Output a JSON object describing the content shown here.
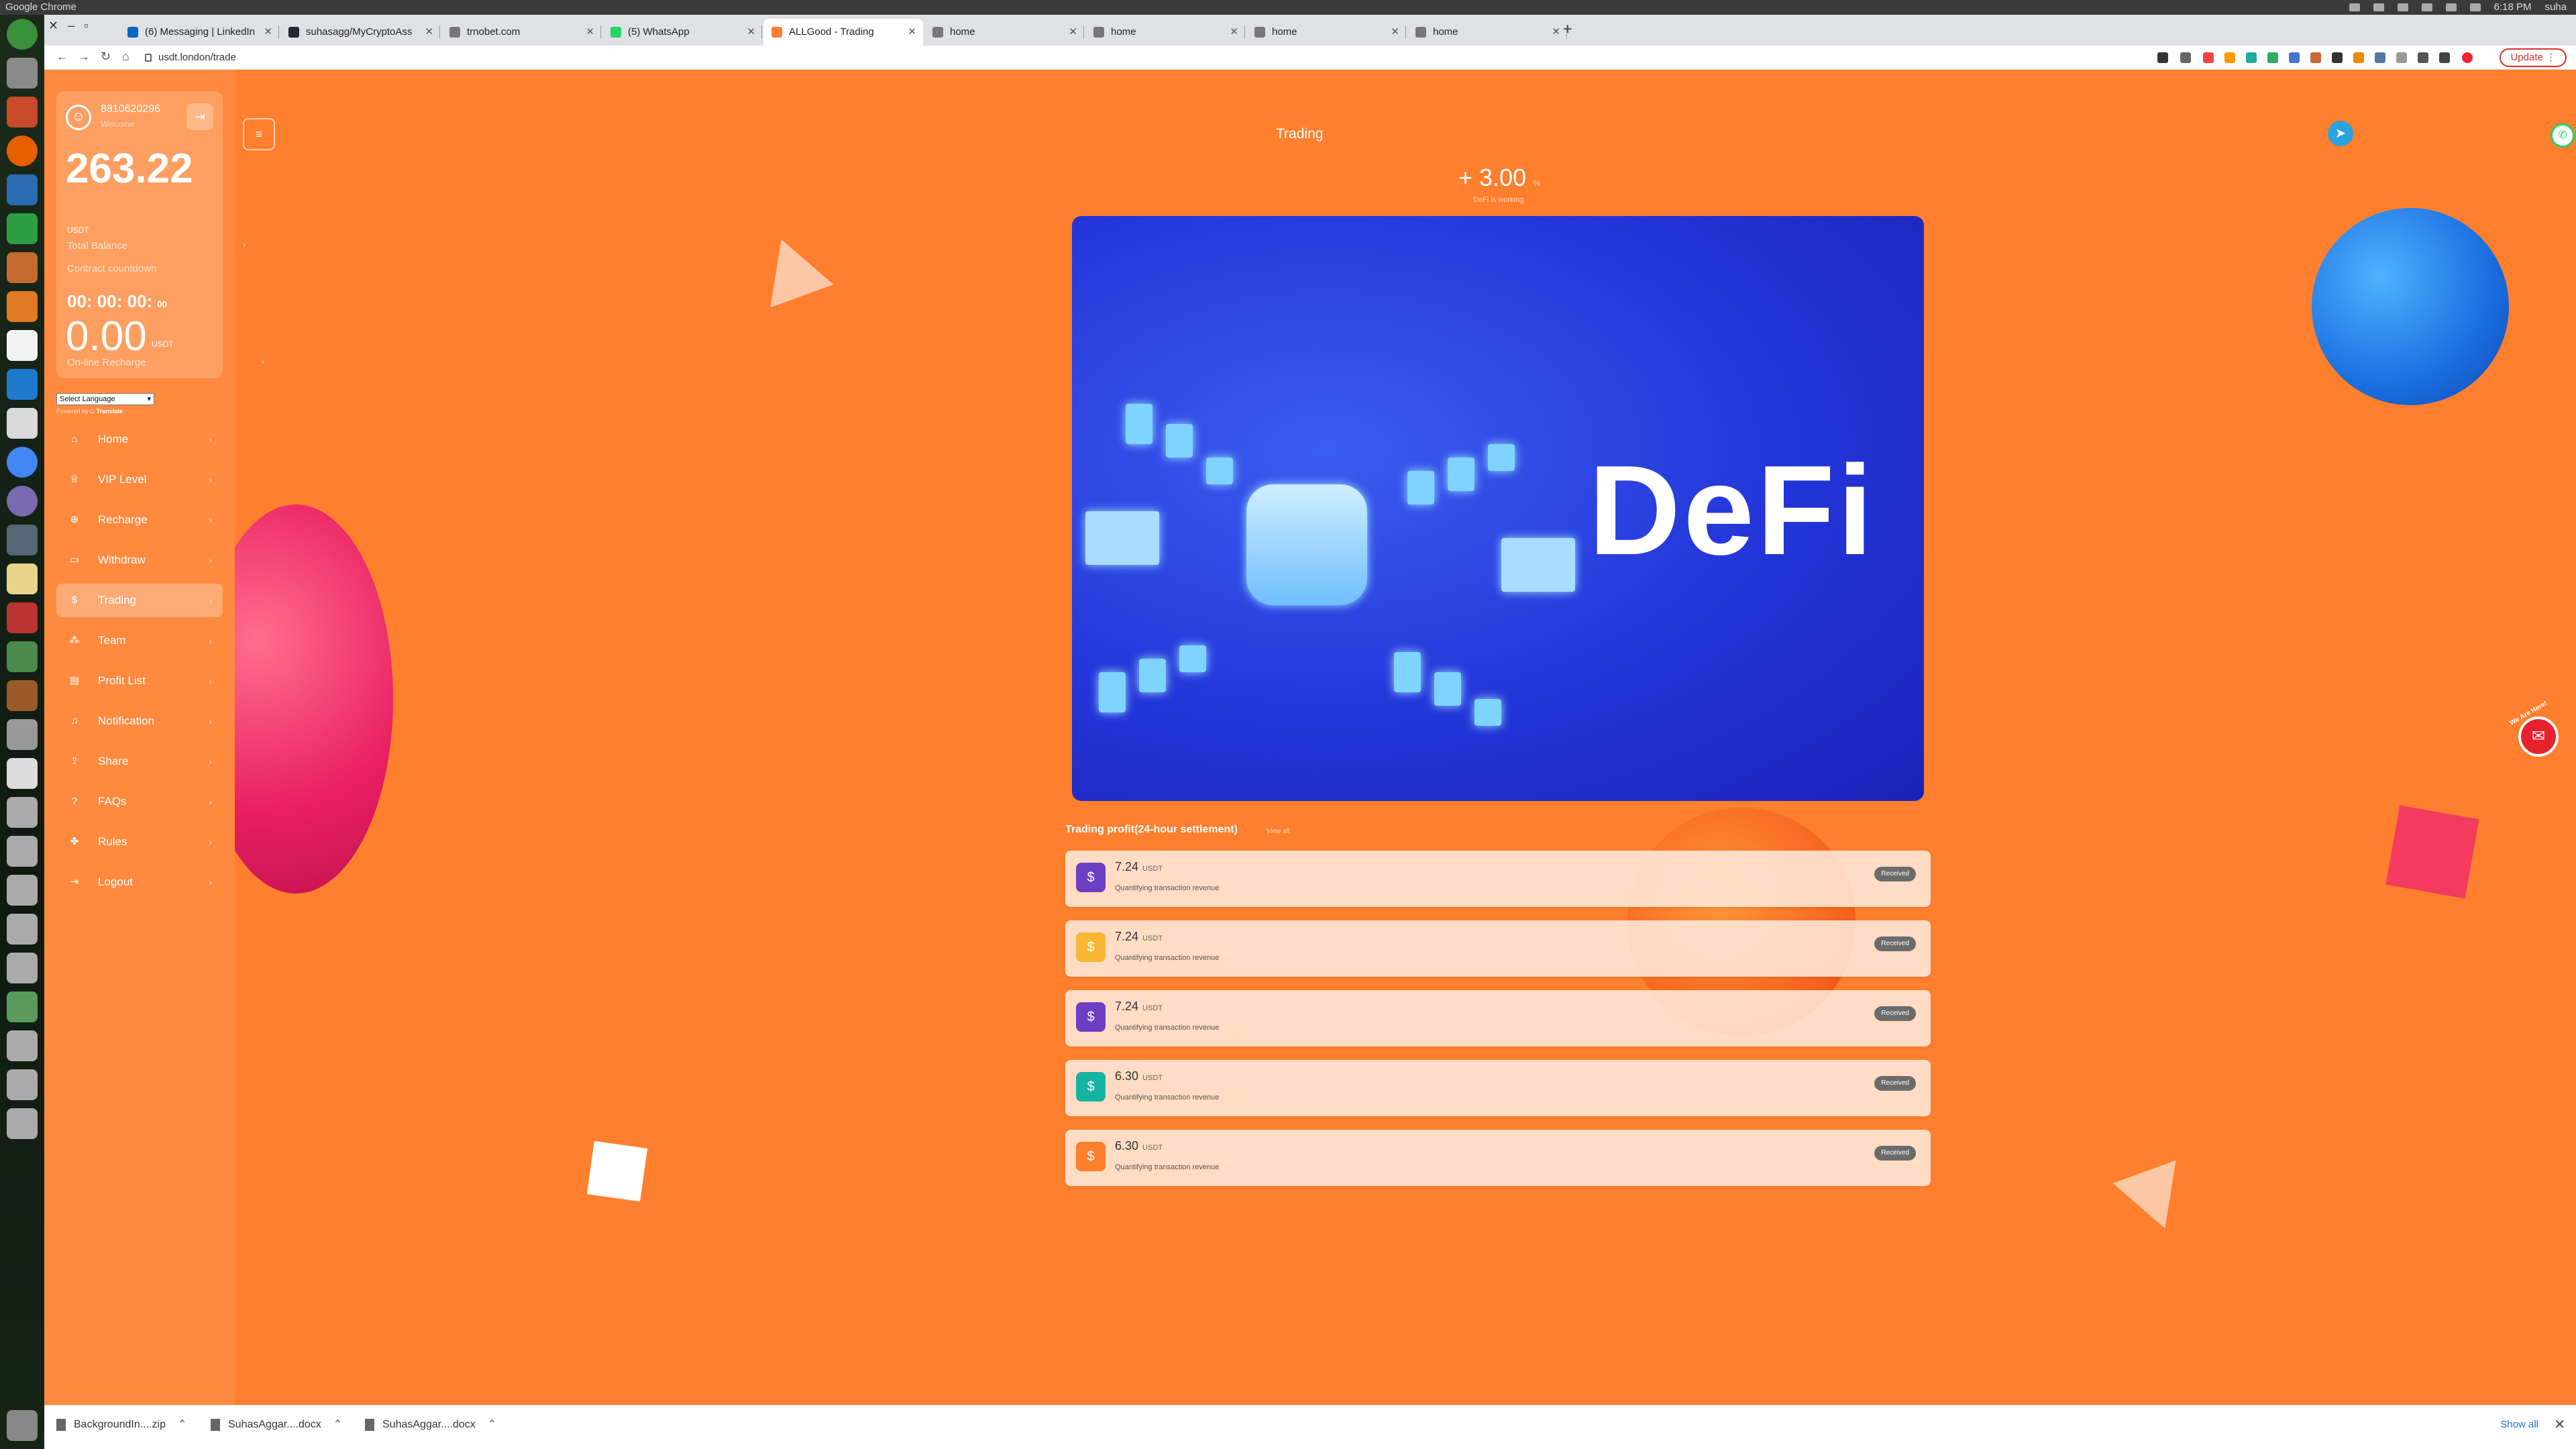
{
  "system": {
    "app_title": "Google Chrome",
    "time": "6:18 PM",
    "user": "suha"
  },
  "browser": {
    "tabs": [
      {
        "label": "(6) Messaging | LinkedIn",
        "fav": "#0a66c2"
      },
      {
        "label": "suhasagg/MyCryptoAss",
        "fav": "#24292f"
      },
      {
        "label": "trnobet.com",
        "fav": "#777777"
      },
      {
        "label": "(5) WhatsApp",
        "fav": "#25d366"
      },
      {
        "label": "ALLGood - Trading",
        "fav": "#fe7f2d"
      },
      {
        "label": "home",
        "fav": "#777777"
      },
      {
        "label": "home",
        "fav": "#777777"
      },
      {
        "label": "home",
        "fav": "#777777"
      },
      {
        "label": "home",
        "fav": "#777777"
      }
    ],
    "url": "usdt.london/trade",
    "update_label": "Update"
  },
  "sidebar": {
    "user_id": "8810620296",
    "welcome": "Welcome",
    "balance": "263.22",
    "balance_unit": "USDT",
    "total_balance_label": "Total Balance",
    "countdown_label": "Contract countdown",
    "countdown": "00: 00: 00:",
    "countdown_small": "00",
    "recharge_value": "0.00",
    "recharge_unit": "USDT",
    "recharge_label": "On-line Recharge",
    "language_select": "Select Language",
    "powered_by": "Powered by",
    "translate": "Translate",
    "menu": [
      {
        "label": "Home",
        "icon": "⌂"
      },
      {
        "label": "VIP Level",
        "icon": "♕"
      },
      {
        "label": "Recharge",
        "icon": "⊕"
      },
      {
        "label": "Withdraw",
        "icon": "▭"
      },
      {
        "label": "Trading",
        "icon": "$"
      },
      {
        "label": "Team",
        "icon": "⁂"
      },
      {
        "label": "Profit List",
        "icon": "▤"
      },
      {
        "label": "Notification",
        "icon": "♫"
      },
      {
        "label": "Share",
        "icon": "⇪"
      },
      {
        "label": "FAQs",
        "icon": "?"
      },
      {
        "label": "Rules",
        "icon": "✤"
      },
      {
        "label": "Logout",
        "icon": "⇥"
      }
    ]
  },
  "main": {
    "title": "Trading",
    "rate": "+ 3.00",
    "rate_unit": "%",
    "rate_status": "DeFi is working",
    "banner_text": "DeFi",
    "profit_title": "Trading profit(24-hour settlement)",
    "view_all": "View all",
    "profits": [
      {
        "amount": "7.24",
        "unit": "USDT",
        "desc": "Quantifying transaction revenue",
        "status": "Received",
        "color": "#6b3fc2"
      },
      {
        "amount": "7.24",
        "unit": "USDT",
        "desc": "Quantifying transaction revenue",
        "status": "Received",
        "color": "#f7b733"
      },
      {
        "amount": "7.24",
        "unit": "USDT",
        "desc": "Quantifying transaction revenue",
        "status": "Received",
        "color": "#6b3fc2"
      },
      {
        "amount": "6.30",
        "unit": "USDT",
        "desc": "Quantifying transaction revenue",
        "status": "Received",
        "color": "#17b3a3"
      },
      {
        "amount": "6.30",
        "unit": "USDT",
        "desc": "Quantifying transaction revenue",
        "status": "Received",
        "color": "#fe7f2d"
      }
    ],
    "chat_label": "We Are Here!"
  },
  "downloads": {
    "items": [
      "BackgroundIn....zip",
      "SuhasAggar....docx",
      "SuhasAggar....docx"
    ],
    "show_all": "Show all"
  },
  "colors": {
    "page_bg": "#fe7f2d",
    "sidebar_bg": "#fd8a3f",
    "banner": "#2335d8"
  }
}
